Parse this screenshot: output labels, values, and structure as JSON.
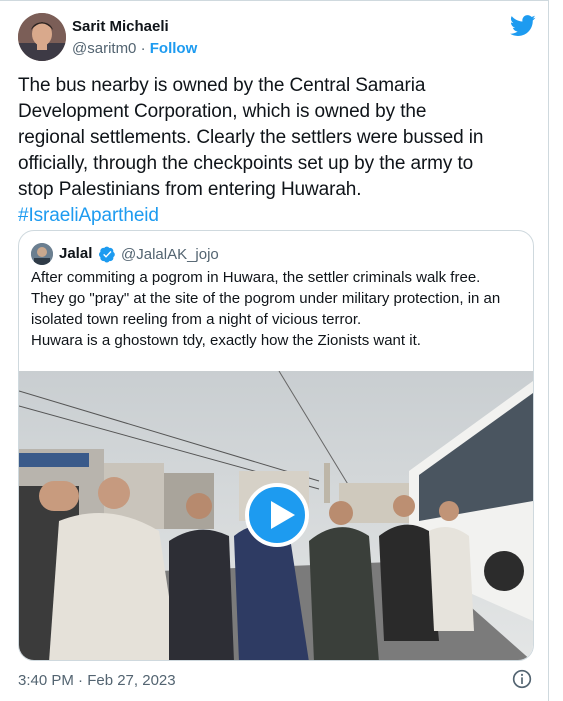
{
  "author": {
    "name": "Sarit Michaeli",
    "handle": "@saritm0",
    "separator": "·",
    "follow_label": "Follow"
  },
  "tweet": {
    "lines": [
      "The bus nearby is owned by the Central Samaria",
      "Development Corporation, which is owned by the",
      "regional settlements. Clearly the settlers were bussed in",
      "officially, through the checkpoints set up by the army to",
      "stop Palestinians from entering Huwarah."
    ],
    "hashtag": "#IsraeliApartheid"
  },
  "quoted": {
    "name": "Jalal",
    "handle": "@JalalAK_jojo",
    "lines": [
      "After commiting a pogrom in Huwara, the settler criminals walk free.",
      "They go \"pray\" at the site of the pogrom under military protection, in an",
      "isolated town reeling from a night of vicious terror.",
      "Huwara is a ghostown tdy, exactly how the Zionists want it."
    ],
    "media": {
      "type": "video",
      "has_play_button": true
    }
  },
  "footer": {
    "timestamp": "3:40 PM · Feb 27, 2023"
  },
  "icons": {
    "brand": "twitter-bird-icon",
    "verified": "verified-badge-icon",
    "play": "play-icon",
    "info": "info-icon"
  },
  "colors": {
    "accent": "#1d9bf0",
    "text": "#0f1419",
    "secondary": "#536471",
    "border": "#cfd9de"
  }
}
